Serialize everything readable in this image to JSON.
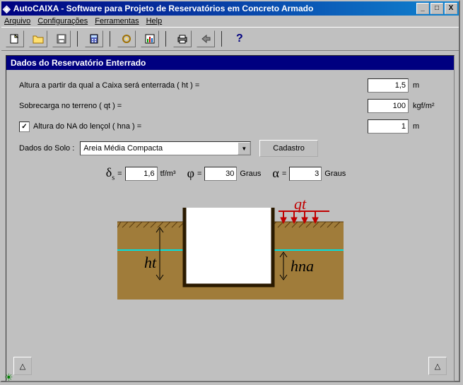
{
  "window": {
    "title": "AutoCAIXA - Software para Projeto de Reservatórios em Concreto Armado",
    "minimize": "_",
    "maximize": "□",
    "close": "X"
  },
  "menu": {
    "file": "Arquivo",
    "config": "Configurações",
    "tools": "Ferramentas",
    "help": "Help"
  },
  "panel": {
    "title": "Dados do Reservatório Enterrado"
  },
  "form": {
    "ht_label": "Altura a partir da qual a Caixa será enterrada ( ht )  =",
    "ht_value": "1,5",
    "ht_unit": "m",
    "qt_label": "Sobrecarga no terreno ( qt ) =",
    "qt_value": "100",
    "qt_unit": "kgf/m²",
    "hna_label": "Altura do NA do lençol ( hna ) =",
    "hna_value": "1",
    "hna_unit": "m",
    "hna_checked": "✓",
    "soil_label": "Dados do Solo :",
    "soil_value": "Areia Média Compacta",
    "cadastro": "Cadastro"
  },
  "params": {
    "delta_sym": "δ",
    "delta_sub": "s",
    "eq": "=",
    "delta_value": "1,6",
    "delta_unit": "tf/m³",
    "phi_sym": "φ",
    "phi_value": "30",
    "phi_unit": "Graus",
    "alpha_sym": "α",
    "alpha_value": "3",
    "alpha_unit": "Graus"
  },
  "diagram": {
    "qt_label": "qt",
    "ht_label": "ht",
    "hna_label": "hna"
  },
  "nav": {
    "triangle": "△"
  }
}
